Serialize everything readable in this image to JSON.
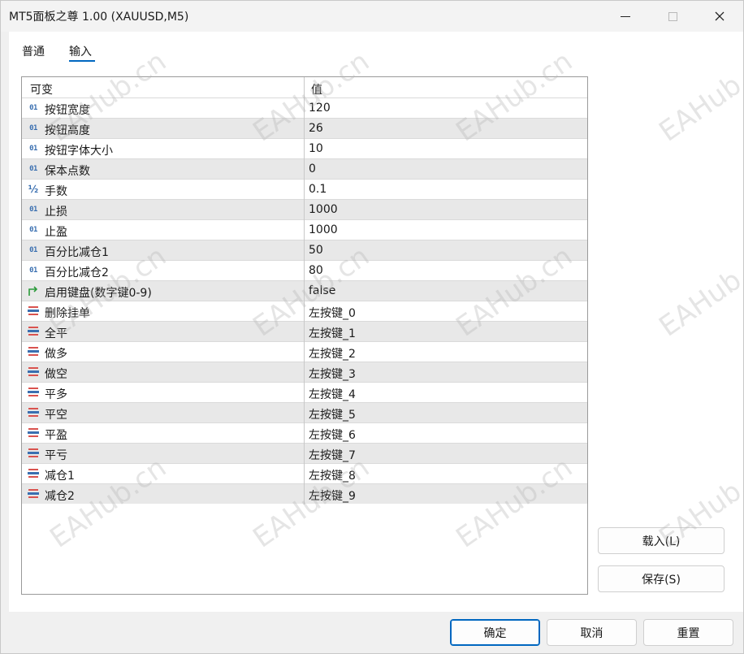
{
  "window": {
    "title": "MT5面板之尊 1.00 (XAUUSD,M5)"
  },
  "tabs": [
    {
      "label": "普通"
    },
    {
      "label": "输入"
    }
  ],
  "grid": {
    "headers": {
      "name": "可变",
      "value": "值"
    },
    "rows": [
      {
        "icon": "int-icon",
        "name": "按钮宽度",
        "value": "120"
      },
      {
        "icon": "int-icon",
        "name": "按钮高度",
        "value": "26"
      },
      {
        "icon": "int-icon",
        "name": "按钮字体大小",
        "value": "10"
      },
      {
        "icon": "int-icon",
        "name": "保本点数",
        "value": "0"
      },
      {
        "icon": "double-icon",
        "name": "手数",
        "value": "0.1"
      },
      {
        "icon": "int-icon",
        "name": "止损",
        "value": "1000"
      },
      {
        "icon": "int-icon",
        "name": "止盈",
        "value": "1000"
      },
      {
        "icon": "int-icon",
        "name": "百分比减仓1",
        "value": "50"
      },
      {
        "icon": "int-icon",
        "name": "百分比减仓2",
        "value": "80"
      },
      {
        "icon": "bool-icon",
        "name": "启用键盘(数字键0-9)",
        "value": "false"
      },
      {
        "icon": "enum-icon",
        "name": "删除挂单",
        "value": "左按键_0"
      },
      {
        "icon": "enum-icon",
        "name": "全平",
        "value": "左按键_1"
      },
      {
        "icon": "enum-icon",
        "name": "做多",
        "value": "左按键_2"
      },
      {
        "icon": "enum-icon",
        "name": "做空",
        "value": "左按键_3"
      },
      {
        "icon": "enum-icon",
        "name": "平多",
        "value": "左按键_4"
      },
      {
        "icon": "enum-icon",
        "name": "平空",
        "value": "左按键_5"
      },
      {
        "icon": "enum-icon",
        "name": "平盈",
        "value": "左按键_6"
      },
      {
        "icon": "enum-icon",
        "name": "平亏",
        "value": "左按键_7"
      },
      {
        "icon": "enum-icon",
        "name": "减仓1",
        "value": "左按键_8"
      },
      {
        "icon": "enum-icon",
        "name": "减仓2",
        "value": "左按键_9"
      }
    ]
  },
  "side_buttons": {
    "load": "载入(L)",
    "save": "保存(S)"
  },
  "footer": {
    "ok": "确定",
    "cancel": "取消",
    "reset": "重置"
  },
  "watermark": "EAHub.cn",
  "colors": {
    "accent": "#0067c0",
    "row_alt": "#e8e8e8",
    "int_icon": "#3a6fb0",
    "bool_icon": "#2a9a3a",
    "enum_icon_red": "#d9534f",
    "enum_icon_blue": "#3a6fb0"
  }
}
